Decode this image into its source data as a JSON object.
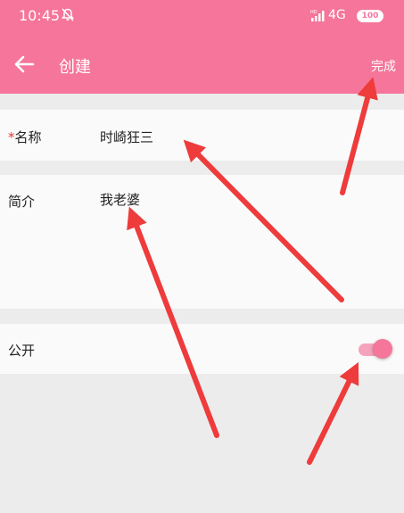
{
  "status_bar": {
    "time": "10:45",
    "signal_label": "HD",
    "network": "4G",
    "battery": "100"
  },
  "toolbar": {
    "title": "创建",
    "done_label": "完成"
  },
  "form": {
    "name_required_mark": "*",
    "name_label": "名称",
    "name_value": "时崎狂三",
    "intro_label": "简介",
    "intro_value": "我老婆",
    "public_label": "公开",
    "public_on": true
  },
  "colors": {
    "accent": "#f5759b",
    "annotation_arrow": "#ee3b3b"
  }
}
